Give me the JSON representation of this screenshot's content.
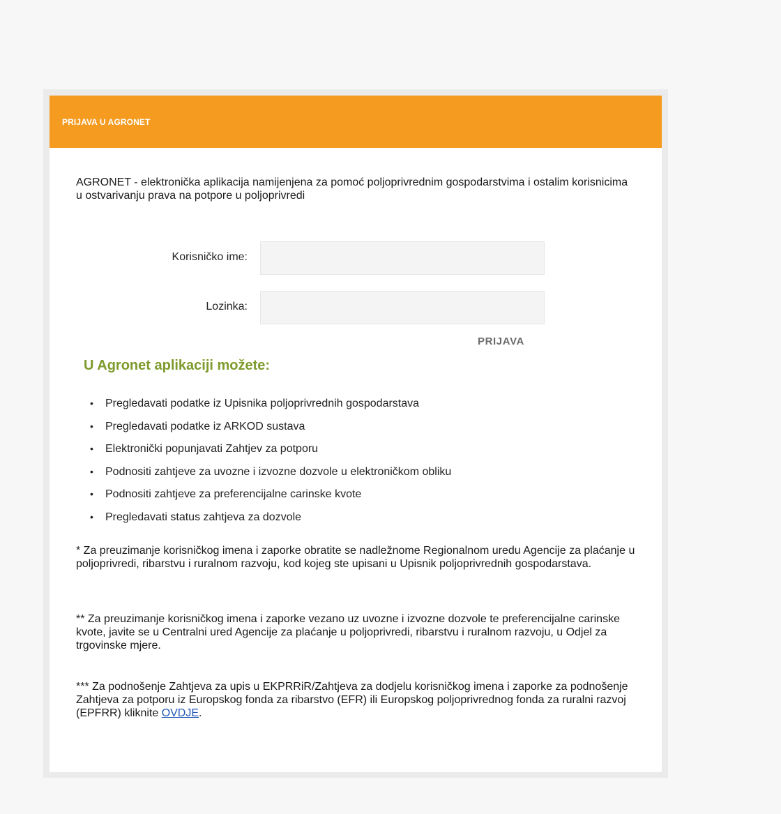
{
  "header": {
    "title": "PRIJAVA U AGRONET"
  },
  "intro": {
    "text": "AGRONET - elektronička aplikacija namijenjena za pomoć poljoprivrednim gospodarstvima i ostalim korisnicima u ostvarivanju prava na potpore u poljoprivredi"
  },
  "login": {
    "username_label": "Korisničko ime:",
    "username_value": "",
    "password_label": "Lozinka:",
    "password_value": "",
    "submit_label": "PRIJAVA"
  },
  "features": {
    "heading": "U Agronet aplikaciji možete:",
    "bullet": "•",
    "items": [
      "Pregledavati podatke iz Upisnika poljoprivrednih gospodarstava",
      "Pregledavati podatke iz ARKOD sustava",
      "Elektronički popunjavati Zahtjev za potporu",
      "Podnositi zahtjeve za uvozne i izvozne dozvole u elektroničkom obliku",
      "Podnositi zahtjeve za preferencijalne carinske kvote",
      "Pregledavati status zahtjeva za dozvole"
    ]
  },
  "notes": {
    "note1": "* Za preuzimanje korisničkog imena i zaporke obratite se nadležnome Regionalnom uredu Agencije za plaćanje u poljoprivredi, ribarstvu i ruralnom razvoju, kod kojeg ste upisani u Upisnik poljoprivrednih gospodarstava.",
    "note2": "** Za preuzimanje korisničkog imena i zaporke vezano uz uvozne i izvozne dozvole te preferencijalne carinske kvote, javite se u Centralni ured Agencije za plaćanje u poljoprivredi, ribarstvu i ruralnom razvoju, u Odjel za trgovinske mjere.",
    "note3_before": "*** Za podnošenje Zahtjeva za upis u EKPRRiR/Zahtjeva za dodjelu korisničkog imena i zaporke za podnošenje Zahtjeva za potporu iz Europskog fonda za ribarstvo (EFR) ili Europskog poljoprivrednog fonda za ruralni razvoj (EPFRR) kliknite ",
    "note3_link": "OVDJE",
    "note3_after": "."
  },
  "colors": {
    "header_bg": "#f59b1f",
    "heading_green": "#7d9a2a",
    "link_blue": "#1f57b8"
  }
}
